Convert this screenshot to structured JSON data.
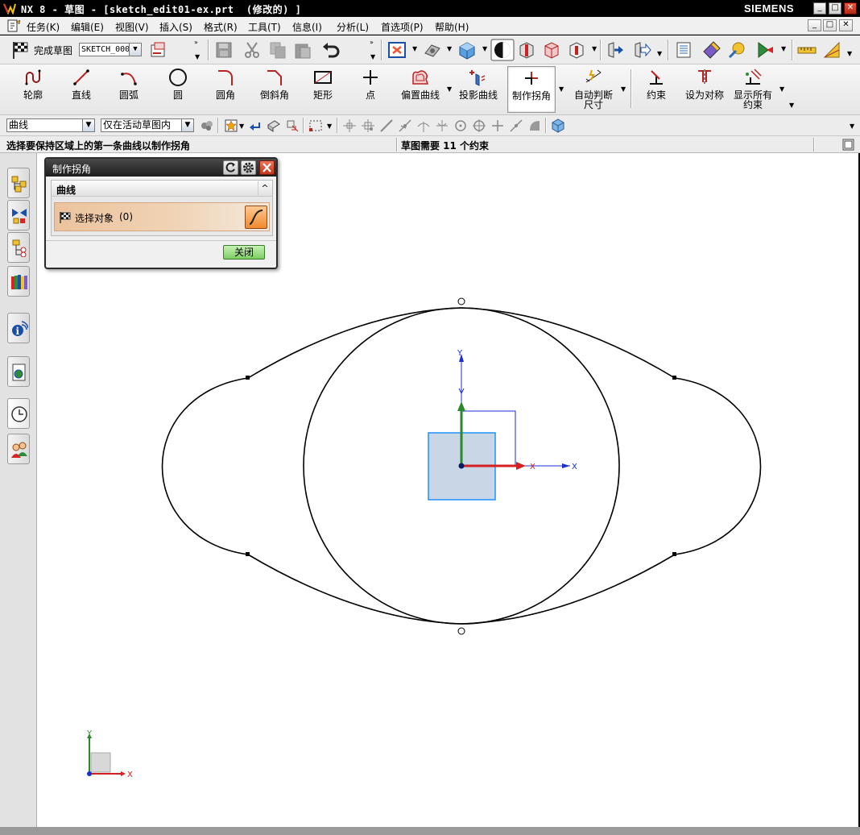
{
  "window": {
    "title": "NX 8 - 草图 - [sketch_edit01-ex.prt  (修改的) ]",
    "brand": "SIEMENS",
    "btn_min": "_",
    "btn_max": "□",
    "btn_close": "✕"
  },
  "menubar": {
    "items": [
      "任务(K)",
      "编辑(E)",
      "视图(V)",
      "插入(S)",
      "格式(R)",
      "工具(T)",
      "信息(I)",
      "分析(L)",
      "首选项(P)",
      "帮助(H)"
    ]
  },
  "toolbar1": {
    "finish_sketch_label": "完成草图",
    "sketch_name": "SKETCH_000",
    "overflow": "»"
  },
  "sketch_tools": [
    {
      "label": "轮廓",
      "icon": "profile-icon"
    },
    {
      "label": "直线",
      "icon": "line-icon"
    },
    {
      "label": "圆弧",
      "icon": "arc-icon"
    },
    {
      "label": "圆",
      "icon": "circle-icon"
    },
    {
      "label": "圆角",
      "icon": "fillet-icon"
    },
    {
      "label": "倒斜角",
      "icon": "chamfer-icon"
    },
    {
      "label": "矩形",
      "icon": "rectangle-icon"
    },
    {
      "label": "点",
      "icon": "point-icon"
    },
    {
      "label": "偏置曲线",
      "icon": "offset-curve-icon"
    },
    {
      "label": "投影曲线",
      "icon": "project-curve-icon"
    },
    {
      "label": "制作拐角",
      "icon": "make-corner-icon"
    },
    {
      "label_line1": "自动判断",
      "label_line2": "尺寸",
      "icon": "inferred-dimension-icon"
    },
    {
      "label": "约束",
      "icon": "constraint-icon"
    },
    {
      "label": "设为对称",
      "icon": "make-symmetric-icon"
    },
    {
      "label_line1": "显示所有",
      "label_line2": "约束",
      "icon": "show-all-constraints-icon"
    }
  ],
  "selection_bar": {
    "type_filter": "曲线",
    "scope_filter": "仅在活动草图内"
  },
  "cue_line": {
    "prompt": "选择要保持区域上的第一条曲线以制作拐角",
    "status": "草图需要  11  个约束"
  },
  "dialog": {
    "title": "制作拐角",
    "group_title": "曲线",
    "select_label": "选择对象",
    "select_count": "(0)",
    "close_button": "关闭",
    "collapse_glyph": "^"
  },
  "axes": {
    "x_label": "X",
    "y_label": "Y"
  },
  "colors": {
    "x_axis": "#d42020",
    "y_axis": "#2a8a2a",
    "z_axis": "#1a2fd0",
    "sketch_curve": "#000000",
    "csys_plane": "#c9d6e6"
  }
}
